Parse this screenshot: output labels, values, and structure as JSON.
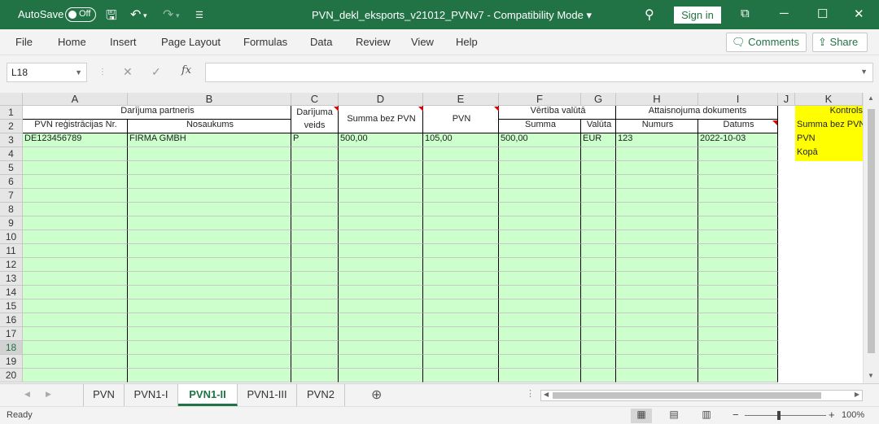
{
  "titlebar": {
    "autosave_label": "AutoSave",
    "autosave_state": "Off",
    "doc_title": "PVN_dekl_eksports_v21012_PVNv7  -  Compatibility Mode  ▾",
    "signin": "Sign in"
  },
  "menu": {
    "items": [
      "File",
      "Home",
      "Insert",
      "Page Layout",
      "Formulas",
      "Data",
      "Review",
      "View",
      "Help"
    ],
    "comments": "Comments",
    "share": "Share"
  },
  "formula_bar": {
    "name_box": "L18",
    "formula": ""
  },
  "columns": [
    "A",
    "B",
    "C",
    "D",
    "E",
    "F",
    "G",
    "H",
    "I",
    "J",
    "K"
  ],
  "rows": [
    "1",
    "2",
    "3",
    "4",
    "5",
    "6",
    "7",
    "8",
    "9",
    "10",
    "11",
    "12",
    "13",
    "14",
    "15",
    "16",
    "17",
    "18",
    "19",
    "20"
  ],
  "headers": {
    "partner": "Darījuma partneris",
    "reg_nr": "PVN reģistrācijas Nr.",
    "name": "Nosaukums",
    "type_l1": "Darījuma",
    "type_l2": "veids",
    "sum_excl": "Summa bez PVN",
    "vat": "PVN",
    "fx_value": "Vērtība valūtā",
    "fx_sum": "Summa",
    "fx_currency": "Valūta",
    "doc": "Attaisnojuma dokuments",
    "doc_nr": "Numurs",
    "doc_date": "Datums"
  },
  "row3": {
    "reg_nr": "DE123456789",
    "name": "FIRMA GMBH",
    "type": "P",
    "sum_excl": "500,00",
    "vat": "105,00",
    "fx_sum": "500,00",
    "fx_currency": "EUR",
    "doc_nr": "123",
    "doc_date": "2022-10-03"
  },
  "control": {
    "title": "Kontrols",
    "line1": "Summa bez PVN",
    "line2": "PVN",
    "line3": "Kopā"
  },
  "sheets": {
    "tabs": [
      "PVN",
      "PVN1-I",
      "PVN1-II",
      "PVN1-III",
      "PVN2"
    ],
    "active": "PVN1-II"
  },
  "status": {
    "text": "Ready",
    "zoom": "100%"
  },
  "colors": {
    "brand": "#217346",
    "fill_green": "#ccffcc",
    "fill_yellow": "#ffff00"
  }
}
